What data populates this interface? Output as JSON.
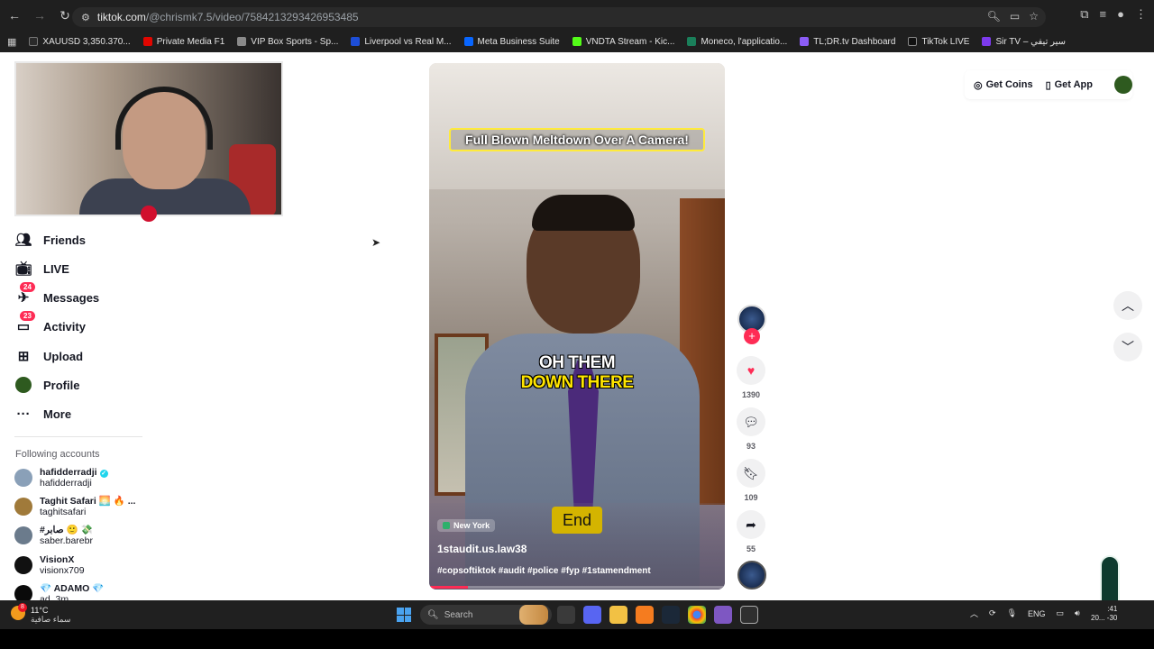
{
  "browser": {
    "url_host": "tiktok.com",
    "url_path": "/@chrismk7.5/video/7584213293426953485"
  },
  "bookmarks": [
    {
      "label": "XAUUSD 3,350.370...",
      "color": "#2a2a2a"
    },
    {
      "label": "Private Media F1",
      "color": "#e10600"
    },
    {
      "label": "VIP Box Sports - Sp...",
      "color": "#3a3a3a"
    },
    {
      "label": "Liverpool vs Real M...",
      "color": "#1d4ed8"
    },
    {
      "label": "Meta Business Suite",
      "color": "#0866ff"
    },
    {
      "label": "VNDTA Stream - Kic...",
      "color": "#53fc18"
    },
    {
      "label": "Moneco, l'applicatio...",
      "color": "#1a7f5a"
    },
    {
      "label": "TL;DR.tv Dashboard",
      "color": "#8b5cf6"
    },
    {
      "label": "TikTok LIVE",
      "color": "#111111"
    },
    {
      "label": "Sir TV – سير تيفي",
      "color": "#7c3aed"
    }
  ],
  "sidebar": {
    "items": [
      {
        "label": "Friends",
        "icon": "friends-icon"
      },
      {
        "label": "LIVE",
        "icon": "live-tv-icon"
      },
      {
        "label": "Messages",
        "icon": "messages-icon",
        "badge": "24"
      },
      {
        "label": "Activity",
        "icon": "activity-icon",
        "badge": "23"
      },
      {
        "label": "Upload",
        "icon": "upload-icon"
      },
      {
        "label": "Profile",
        "icon": "profile-avatar"
      },
      {
        "label": "More",
        "icon": "more-icon"
      }
    ],
    "following_title": "Following accounts",
    "accounts": [
      {
        "name": "hafidderradji",
        "handle": "hafidderradji",
        "verified": true,
        "color": "#8aa0b8"
      },
      {
        "name": "Taghit Safari 🌅 🔥 ...",
        "handle": "taghitsafari",
        "verified": false,
        "color": "#a07a3a"
      },
      {
        "name": "#صابر 🙂 💸",
        "handle": "saber.barebr",
        "verified": false,
        "color": "#6b7b8c"
      },
      {
        "name": "VisionX",
        "handle": "visionx709",
        "verified": false,
        "color": "#111111"
      },
      {
        "name": "💎 ADAMO 💎",
        "handle": "ad_3m",
        "verified": false,
        "color": "#0a0a0a"
      }
    ]
  },
  "video": {
    "caption_top": "Full Blown Meltdown Over A Camera!",
    "caption_mid_1": "OH THEM",
    "caption_mid_2": "DOWN THERE",
    "location": "New York",
    "end_label": "End",
    "author": "1staudit.us.law38",
    "tags": "#copsoftiktok #audit #police #fyp #1stamendment",
    "progress_fraction": 0.13
  },
  "actions": {
    "likes": "1390",
    "comments": "93",
    "saves": "109",
    "shares": "55"
  },
  "topright": {
    "coins_label": "Get Coins",
    "app_label": "Get App"
  },
  "taskbar": {
    "temp": "11°C",
    "weather_desc": "سماء صافية",
    "weather_badge": "8",
    "search_placeholder": "Search",
    "lang": "ENG",
    "time": ":41",
    "date": "20... -30"
  }
}
